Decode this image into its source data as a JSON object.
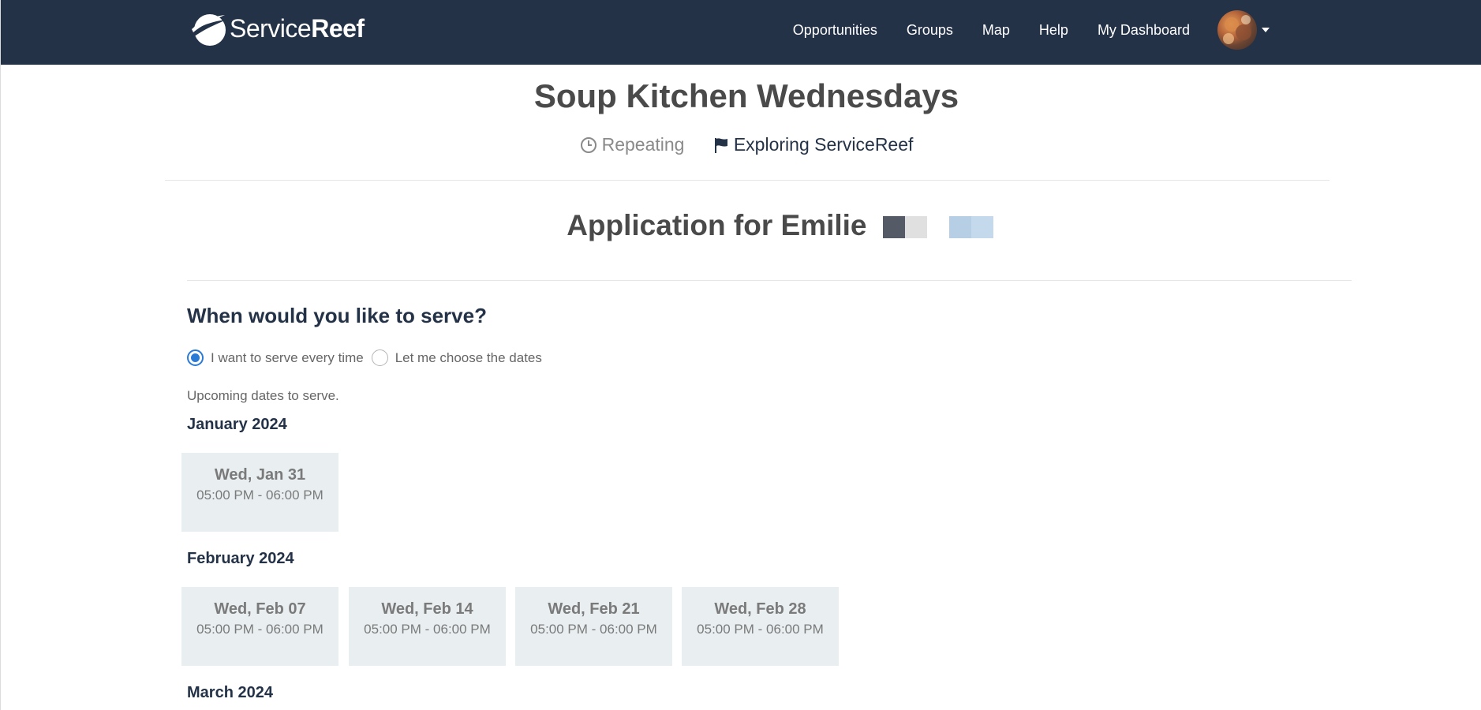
{
  "nav": {
    "logo_light": "Service",
    "logo_bold": "Reef",
    "links": [
      "Opportunities",
      "Groups",
      "Map",
      "Help",
      "My Dashboard"
    ]
  },
  "event": {
    "title": "Soup Kitchen Wednesdays",
    "schedule": "Repeating",
    "organization": "Exploring ServiceReef"
  },
  "application": {
    "title": "Application for Emilie"
  },
  "form": {
    "question": "When would you like to serve?",
    "option_all": "I want to serve every time",
    "option_choose": "Let me choose the dates",
    "selected": "option_all",
    "upcoming_label": "Upcoming dates to serve."
  },
  "months": [
    {
      "label": "January 2024",
      "dates": [
        {
          "day": "Wed, Jan 31",
          "time": "05:00 PM - 06:00 PM"
        }
      ]
    },
    {
      "label": "February 2024",
      "dates": [
        {
          "day": "Wed, Feb 07",
          "time": "05:00 PM - 06:00 PM"
        },
        {
          "day": "Wed, Feb 14",
          "time": "05:00 PM - 06:00 PM"
        },
        {
          "day": "Wed, Feb 21",
          "time": "05:00 PM - 06:00 PM"
        },
        {
          "day": "Wed, Feb 28",
          "time": "05:00 PM - 06:00 PM"
        }
      ]
    },
    {
      "label": "March 2024",
      "dates": []
    }
  ],
  "colors": {
    "navbar": "#243248",
    "card": "#e9eef1",
    "radio_accent": "#2b7bd6"
  }
}
